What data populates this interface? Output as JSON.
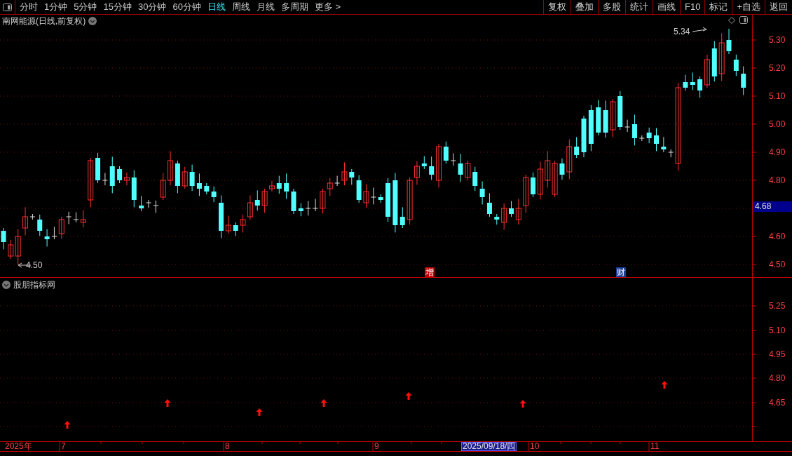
{
  "toolbar": {
    "periods": [
      {
        "label": "分时",
        "selected": false
      },
      {
        "label": "1分钟",
        "selected": false
      },
      {
        "label": "5分钟",
        "selected": false
      },
      {
        "label": "15分钟",
        "selected": false
      },
      {
        "label": "30分钟",
        "selected": false
      },
      {
        "label": "60分钟",
        "selected": false
      },
      {
        "label": "日线",
        "selected": true
      },
      {
        "label": "周线",
        "selected": false
      },
      {
        "label": "月线",
        "selected": false
      },
      {
        "label": "多周期",
        "selected": false
      },
      {
        "label": "更多 >",
        "selected": false
      }
    ],
    "buttons": [
      "复权",
      "叠加",
      "多股",
      "统计",
      "画线",
      "F10",
      "标记",
      "+自选",
      "返回"
    ]
  },
  "chart": {
    "title": "南网能源(日线,前复权)",
    "y_labels": [
      "5.30",
      "5.20",
      "5.10",
      "5.00",
      "4.90",
      "4.80",
      "4.60",
      "4.50"
    ],
    "current_price": "4.68",
    "high_note": "5.34",
    "low_note": "4.50",
    "markers": [
      {
        "text": "增",
        "color": "#c00000"
      },
      {
        "text": "财",
        "color": "#1c3c9c"
      }
    ]
  },
  "indicator": {
    "title": "股朋指标网",
    "y_labels": [
      "5.25",
      "5.10",
      "4.95",
      "4.80",
      "4.65"
    ]
  },
  "time_axis": {
    "labels": [
      "2025年",
      "7",
      "8",
      "9",
      "10",
      "11"
    ],
    "cursor_date": "2025/09/18/四"
  }
}
